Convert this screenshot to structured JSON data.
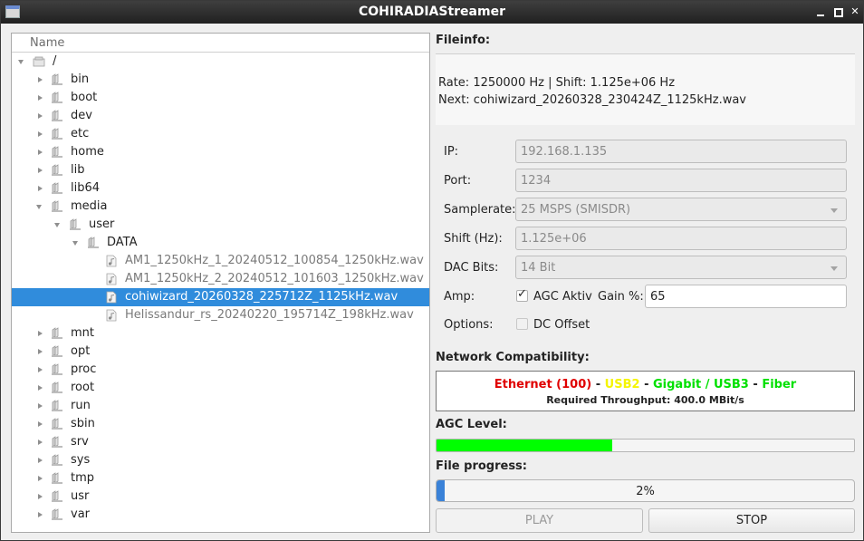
{
  "window": {
    "title": "COHIRADIAStreamer"
  },
  "tree": {
    "header": "Name",
    "rows": [
      {
        "label": "/",
        "level": 0,
        "arrow": "down",
        "type": "drive"
      },
      {
        "label": "bin",
        "level": 1,
        "arrow": "right",
        "type": "folder"
      },
      {
        "label": "boot",
        "level": 1,
        "arrow": "right",
        "type": "folder"
      },
      {
        "label": "dev",
        "level": 1,
        "arrow": "right",
        "type": "folder"
      },
      {
        "label": "etc",
        "level": 1,
        "arrow": "right",
        "type": "folder"
      },
      {
        "label": "home",
        "level": 1,
        "arrow": "right",
        "type": "folder"
      },
      {
        "label": "lib",
        "level": 1,
        "arrow": "right",
        "type": "folder"
      },
      {
        "label": "lib64",
        "level": 1,
        "arrow": "right",
        "type": "folder"
      },
      {
        "label": "media",
        "level": 1,
        "arrow": "down",
        "type": "folder"
      },
      {
        "label": "user",
        "level": 2,
        "arrow": "down",
        "type": "folder"
      },
      {
        "label": "DATA",
        "level": 3,
        "arrow": "down",
        "type": "folder"
      },
      {
        "label": "AM1_1250kHz_1_20240512_100854_1250kHz.wav",
        "level": 4,
        "arrow": "none",
        "type": "file"
      },
      {
        "label": "AM1_1250kHz_2_20240512_101603_1250kHz.wav",
        "level": 4,
        "arrow": "none",
        "type": "file"
      },
      {
        "label": "cohiwizard_20260328_225712Z_1125kHz.wav",
        "level": 4,
        "arrow": "none",
        "type": "file",
        "selected": true
      },
      {
        "label": "Helissandur_rs_20240220_195714Z_198kHz.wav",
        "level": 4,
        "arrow": "none",
        "type": "file"
      },
      {
        "label": "mnt",
        "level": 1,
        "arrow": "right",
        "type": "folder"
      },
      {
        "label": "opt",
        "level": 1,
        "arrow": "right",
        "type": "folder"
      },
      {
        "label": "proc",
        "level": 1,
        "arrow": "right",
        "type": "folder"
      },
      {
        "label": "root",
        "level": 1,
        "arrow": "right",
        "type": "folder"
      },
      {
        "label": "run",
        "level": 1,
        "arrow": "right",
        "type": "folder"
      },
      {
        "label": "sbin",
        "level": 1,
        "arrow": "right",
        "type": "folder"
      },
      {
        "label": "srv",
        "level": 1,
        "arrow": "right",
        "type": "folder"
      },
      {
        "label": "sys",
        "level": 1,
        "arrow": "right",
        "type": "folder"
      },
      {
        "label": "tmp",
        "level": 1,
        "arrow": "right",
        "type": "folder"
      },
      {
        "label": "usr",
        "level": 1,
        "arrow": "right",
        "type": "folder"
      },
      {
        "label": "var",
        "level": 1,
        "arrow": "right",
        "type": "folder"
      }
    ]
  },
  "fileinfo": {
    "heading": "Fileinfo:",
    "line1": "Rate: 1250000 Hz | Shift: 1.125e+06 Hz",
    "line2": "Next: cohiwizard_20260328_230424Z_1125kHz.wav"
  },
  "form": {
    "ip_label": "IP:",
    "ip_value": "192.168.1.135",
    "port_label": "Port:",
    "port_value": "1234",
    "samplerate_label": "Samplerate:",
    "samplerate_value": "25 MSPS (SMISDR)",
    "shift_label": "Shift (Hz):",
    "shift_value": "1.125e+06",
    "dacbits_label": "DAC Bits:",
    "dacbits_value": "14 Bit",
    "amp_label": "Amp:",
    "agc_label": "AGC Aktiv",
    "agc_checked": true,
    "gain_label": "Gain %:",
    "gain_value": "65",
    "options_label": "Options:",
    "dcoffset_label": "DC Offset",
    "dcoffset_checked": false
  },
  "network": {
    "heading": "Network Compatibility:",
    "ethernet": "Ethernet (100)",
    "sep1": " - ",
    "usb2": "USB2",
    "sep2": " - ",
    "gigabit": "Gigabit / USB3",
    "sep3": " - ",
    "fiber": "Fiber",
    "throughput": "Required Throughput: 400.0 MBit/s",
    "colors": {
      "ethernet": "#e00000",
      "usb2": "#f5f500",
      "gigabit": "#00e000",
      "fiber": "#00e000"
    }
  },
  "agc": {
    "heading": "AGC Level:",
    "level_fraction": 0.42,
    "color": "#00ff00"
  },
  "progress": {
    "heading": "File progress:",
    "text": "2%",
    "fraction": 0.02,
    "color": "#3a82d8"
  },
  "buttons": {
    "play": "PLAY",
    "stop": "STOP"
  }
}
